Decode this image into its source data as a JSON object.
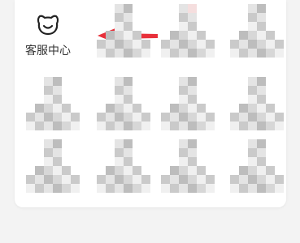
{
  "services": [
    {
      "label": "客服中心",
      "icon": "bear-face-icon"
    }
  ],
  "colors": {
    "card": "#ffffff",
    "page": "#f3f3f3",
    "arrow": "#e8303a",
    "pixelated": [
      "#f0f0f0",
      "#e4e4e4",
      "#d7d7d7",
      "#cacaca",
      "#bdbdbd",
      "#f5dede"
    ]
  }
}
